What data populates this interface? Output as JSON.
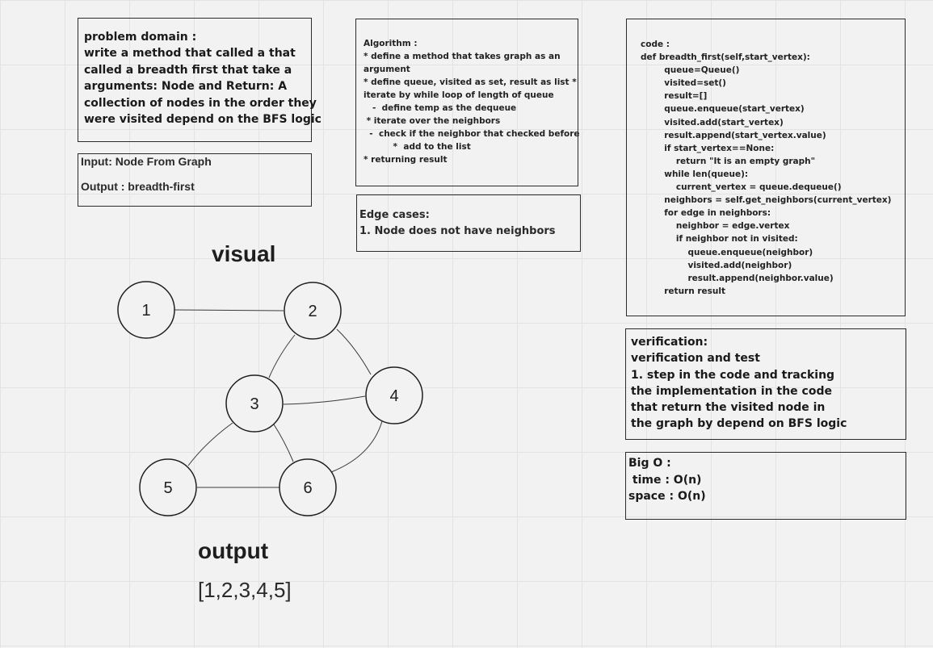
{
  "problem_domain": {
    "lines": [
      "problem domain :",
      "write a method that called a that",
      "called a breadth first that take a",
      "arguments: Node and Return: A",
      "collection of nodes in the order they",
      "were visited depend on the BFS logic"
    ]
  },
  "io": {
    "input": "Input: Node From Graph",
    "output": "Output : breadth-first"
  },
  "algorithm": {
    "lines": [
      "Algorithm :",
      "* define a method that takes graph as an",
      "argument",
      "* define queue, visited as set, result as list *",
      "iterate by while loop of length of queue",
      "   -  define temp as the dequeue",
      " * iterate over the neighbors",
      "  -  check if the neighbor that checked before",
      "          *  add to the list",
      "* returning result"
    ]
  },
  "edge_cases": {
    "lines": [
      "Edge cases:",
      "1. Node does not have neighbors"
    ]
  },
  "code": {
    "lines": [
      "code :",
      "def breadth_first(self,start_vertex):",
      "        queue=Queue()",
      "        visited=set()",
      "        result=[]",
      "        queue.enqueue(start_vertex)",
      "        visited.add(start_vertex)",
      "        result.append(start_vertex.value)",
      "        if start_vertex==None:",
      "            return \"It is an empty graph\"",
      "        while len(queue):",
      "            current_vertex = queue.dequeue()",
      "        neighbors = self.get_neighbors(current_vertex)",
      "        for edge in neighbors:",
      "            neighbor = edge.vertex",
      "            if neighbor not in visited:",
      "                queue.enqueue(neighbor)",
      "                visited.add(neighbor)",
      "                result.append(neighbor.value)",
      "        return result"
    ]
  },
  "verification": {
    "lines": [
      "verification:",
      "verification and test",
      "1. step in the code and tracking",
      "the implementation in the code",
      "that return the visited node in",
      "the graph by depend on BFS logic"
    ]
  },
  "big_o": {
    "lines": [
      "Big O :",
      " time : O(n)",
      "space : O(n)"
    ]
  },
  "visual": {
    "title": "visual",
    "nodes": [
      "1",
      "2",
      "3",
      "4",
      "5",
      "6"
    ],
    "edges": [
      [
        "1",
        "2"
      ],
      [
        "2",
        "3"
      ],
      [
        "2",
        "4"
      ],
      [
        "3",
        "4"
      ],
      [
        "3",
        "5"
      ],
      [
        "3",
        "6"
      ],
      [
        "4",
        "6"
      ],
      [
        "5",
        "6"
      ]
    ]
  },
  "output": {
    "title": "output",
    "value": "[1,2,3,4,5]"
  }
}
